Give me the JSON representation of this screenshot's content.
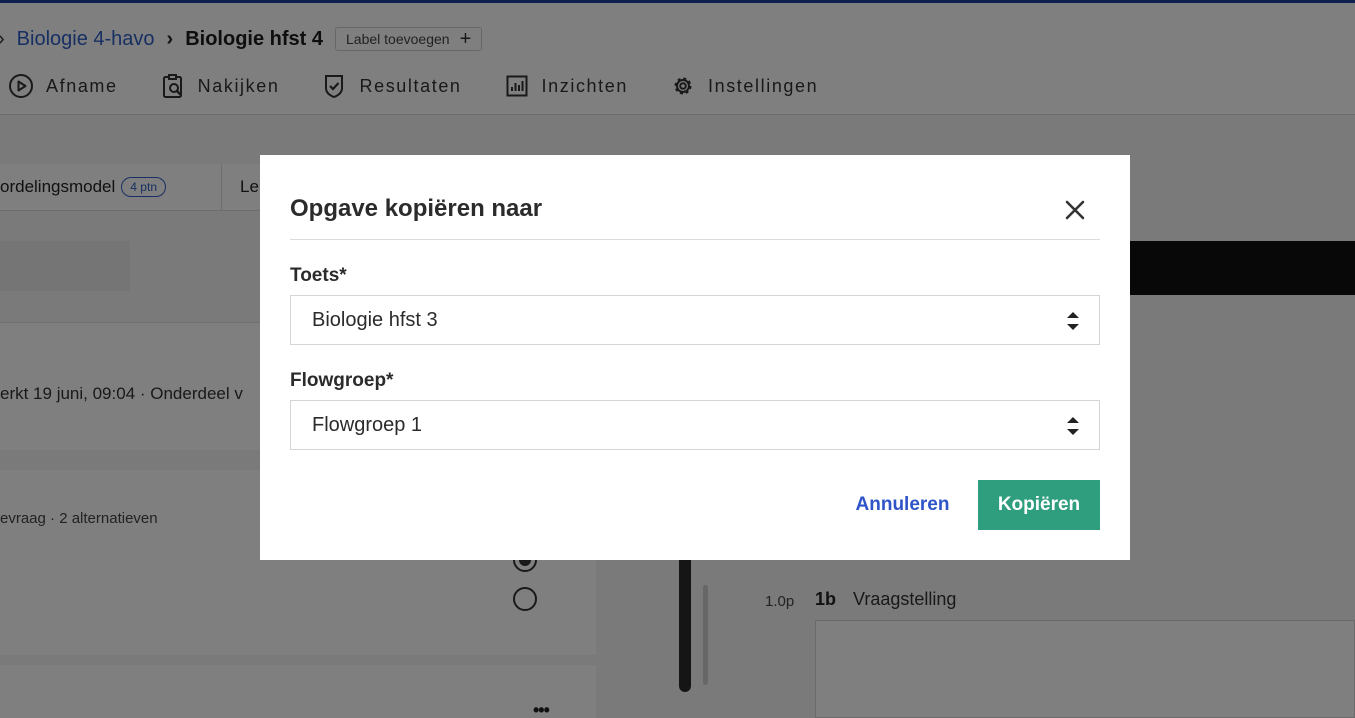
{
  "breadcrumb": {
    "parent": "Biologie 4-havo",
    "current": "Biologie hfst 4",
    "label_add": "Label toevoegen"
  },
  "nav": {
    "items": [
      {
        "label": "Afname",
        "icon": "play-circle-icon"
      },
      {
        "label": "Nakijken",
        "icon": "clipboard-search-icon"
      },
      {
        "label": "Resultaten",
        "icon": "shield-check-icon"
      },
      {
        "label": "Inzichten",
        "icon": "bar-chart-icon"
      },
      {
        "label": "Instellingen",
        "icon": "gear-icon"
      }
    ]
  },
  "background": {
    "tab1_label": "ordelingsmodel",
    "tab1_badge": "4 ptn",
    "tab2_label": "Le",
    "meta1": "erkt 19 juni, 09:04 · Onderdeel v",
    "meta2": "evraag · 2 alternatieven",
    "question_points": "1.0p",
    "question_number": "1b",
    "question_title": "Vraagstelling"
  },
  "modal": {
    "title": "Opgave kopiëren naar",
    "toets_label": "Toets*",
    "toets_value": "Biologie hfst 3",
    "flowgroep_label": "Flowgroep*",
    "flowgroep_value": "Flowgroep 1",
    "cancel_label": "Annuleren",
    "confirm_label": "Kopiëren"
  },
  "colors": {
    "accent_blue": "#2f54c8",
    "primary_green": "#2e9e7e",
    "overlay": "rgba(0,0,0,0.5)"
  }
}
